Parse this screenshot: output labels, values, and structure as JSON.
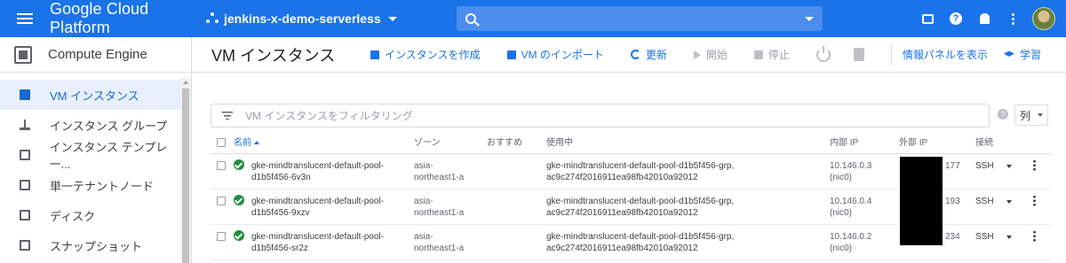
{
  "topbar": {
    "brand": "Google Cloud Platform",
    "project": "jenkins-x-demo-serverless"
  },
  "sidebar": {
    "product": "Compute Engine",
    "items": [
      {
        "label": "VM インスタンス",
        "icon": "vm-instance-icon",
        "active": true
      },
      {
        "label": "インスタンス グループ",
        "icon": "instance-group-icon",
        "active": false
      },
      {
        "label": "インスタンス テンプレー...",
        "icon": "instance-template-icon",
        "active": false
      },
      {
        "label": "単一テナントノード",
        "icon": "sole-tenant-node-icon",
        "active": false
      },
      {
        "label": "ディスク",
        "icon": "disk-icon",
        "active": false
      },
      {
        "label": "スナップショット",
        "icon": "snapshot-icon",
        "active": false
      }
    ]
  },
  "toolbar": {
    "title": "VM インスタンス",
    "create": "インスタンスを作成",
    "import": "VM のインポート",
    "refresh": "更新",
    "start": "開始",
    "stop": "停止",
    "info_panel": "情報パネルを表示",
    "learn": "学習"
  },
  "filter": {
    "placeholder": "VM インスタンスをフィルタリング",
    "columns_label": "列"
  },
  "table": {
    "headers": {
      "name": "名前",
      "zone": "ゾーン",
      "recommendation": "おすすめ",
      "in_use_by": "使用中",
      "internal_ip": "内部 IP",
      "external_ip": "外部 IP",
      "connect": "接続"
    },
    "rows": [
      {
        "name1": "gke-mindtranslucent-default-pool-",
        "name2": "d1b5f456-6v3n",
        "zone1": "asia-",
        "zone2": "northeast1-a",
        "use1": "gke-mindtranslucent-default-pool-d1b5f456-grp,",
        "use2": "ac9c274f2016911ea98fb42010a92012",
        "ip1": "10.146.0.3",
        "ip2": "(nic0)",
        "ext": "177",
        "connect": "SSH"
      },
      {
        "name1": "gke-mindtranslucent-default-pool-",
        "name2": "d1b5f456-9xzv",
        "zone1": "asia-",
        "zone2": "northeast1-a",
        "use1": "gke-mindtranslucent-default-pool-d1b5f456-grp,",
        "use2": "ac9c274f2016911ea98fb42010a92012",
        "ip1": "10.146.0.4",
        "ip2": "(nic0)",
        "ext": "193",
        "connect": "SSH"
      },
      {
        "name1": "gke-mindtranslucent-default-pool-",
        "name2": "d1b5f456-sr2z",
        "zone1": "asia-",
        "zone2": "northeast1-a",
        "use1": "gke-mindtranslucent-default-pool-d1b5f456-grp,",
        "use2": "ac9c274f2016911ea98fb42010a92012",
        "ip1": "10.146.0.2",
        "ip2": "(nic0)",
        "ext": "234",
        "connect": "SSH"
      }
    ]
  }
}
